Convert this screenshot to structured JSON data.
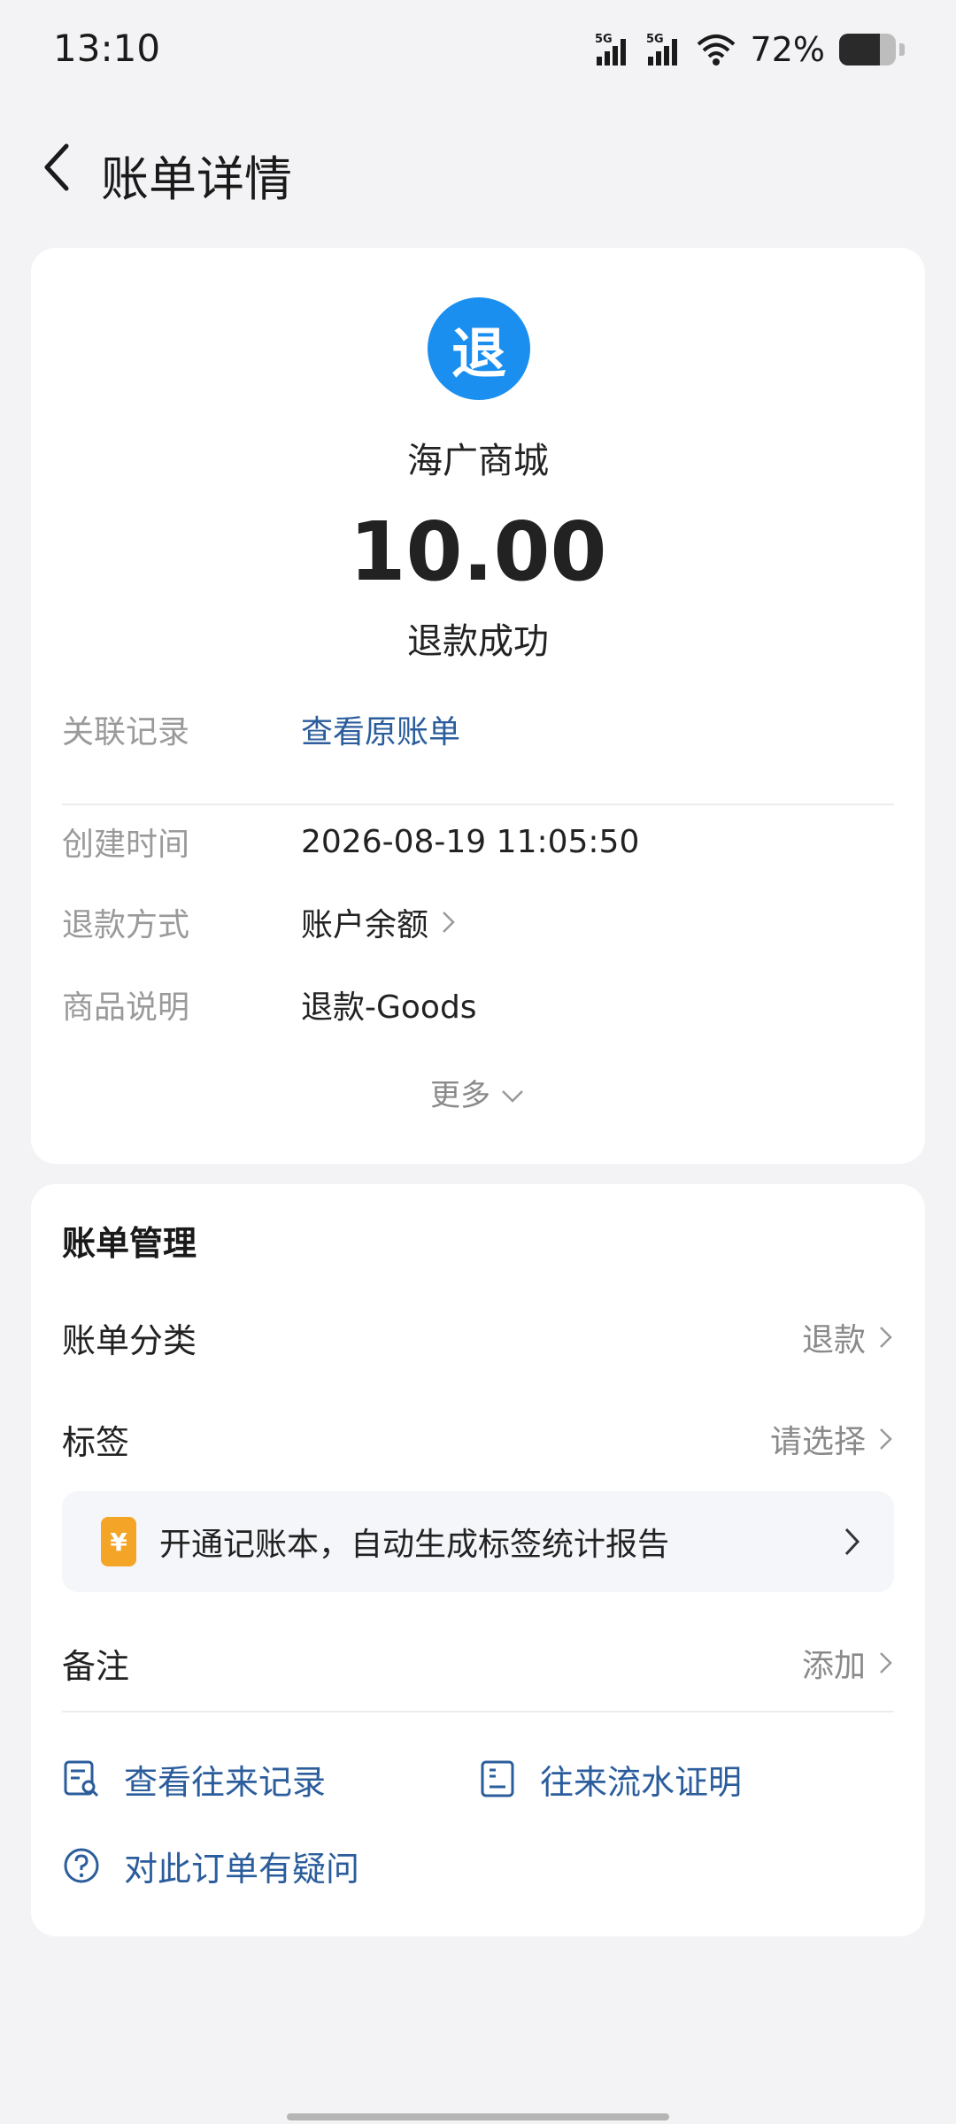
{
  "status_bar": {
    "time": "13:10",
    "signal1_label": "5G",
    "signal2_label": "5G",
    "battery_text": "72%",
    "battery_level": 0.72
  },
  "header": {
    "title": "账单详情"
  },
  "bill": {
    "icon_char": "退",
    "merchant": "海广商城",
    "amount": "10.00",
    "status": "退款成功",
    "related": {
      "label": "关联记录",
      "value": "查看原账单"
    },
    "created": {
      "label": "创建时间",
      "value": "2026-08-19 11:05:50"
    },
    "method": {
      "label": "退款方式",
      "value": "账户余额"
    },
    "goods": {
      "label": "商品说明",
      "value": "退款-Goods"
    },
    "more": "更多"
  },
  "manage": {
    "title": "账单管理",
    "category": {
      "label": "账单分类",
      "value": "退款"
    },
    "tag": {
      "label": "标签",
      "value": "请选择"
    },
    "promo": {
      "icon": "¥",
      "text": "开通记账本，自动生成标签统计报告"
    },
    "note": {
      "label": "备注",
      "value": "添加"
    },
    "actions": {
      "records": "查看往来记录",
      "proof": "往来流水证明",
      "question": "对此订单有疑问"
    }
  },
  "colors": {
    "accent_blue": "#1a8ff0",
    "link_blue": "#2b5d9c",
    "promo_orange": "#f4a426",
    "background": "#f3f3f5"
  },
  "icons": [
    "back-arrow-icon",
    "signal-icon",
    "wifi-icon",
    "battery-icon",
    "chevron-right-icon",
    "chevron-down-icon",
    "records-search-icon",
    "document-proof-icon",
    "question-circle-icon",
    "yuan-icon"
  ]
}
